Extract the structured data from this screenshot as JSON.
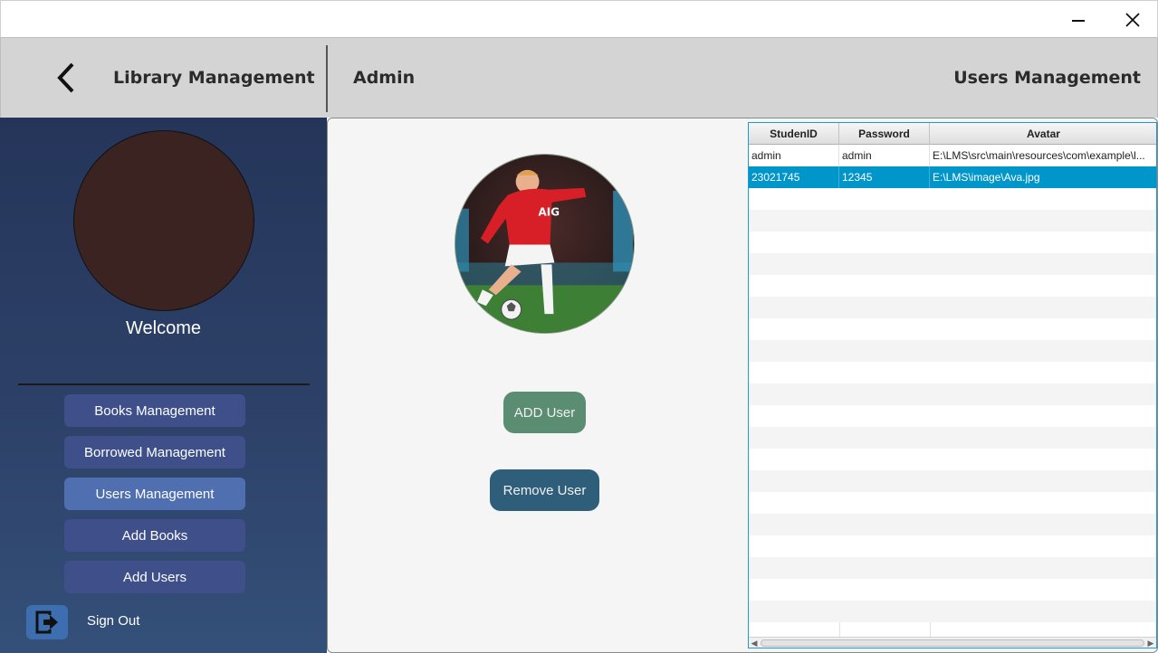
{
  "window": {
    "minimize_icon": "minimize-icon",
    "close_icon": "close-icon"
  },
  "header": {
    "back_icon": "chevron-left-icon",
    "app_title": "Library Management",
    "user_role": "Admin",
    "page_title": "Users Management"
  },
  "sidebar": {
    "welcome": "Welcome",
    "nav": [
      {
        "label": "Books Management",
        "active": false
      },
      {
        "label": "Borrowed Management",
        "active": false
      },
      {
        "label": "Users Management",
        "active": true
      },
      {
        "label": "Add Books",
        "active": false
      },
      {
        "label": "Add Users",
        "active": false
      }
    ],
    "sign_out_label": "Sign Out",
    "sign_out_icon": "sign-out-icon"
  },
  "content": {
    "add_user_label": "ADD User",
    "remove_user_label": "Remove User"
  },
  "table": {
    "columns": [
      "StudenID",
      "Password",
      "Avatar"
    ],
    "rows": [
      [
        "admin",
        "admin",
        "E:\\LMS\\src\\main\\resources\\com\\example\\l..."
      ],
      [
        "23021745",
        "12345",
        "E:\\LMS\\image\\Ava.jpg"
      ]
    ],
    "selected_row": 1
  },
  "colors": {
    "sidebar_bg": "#2d4168",
    "header_bg": "#d4d4d4",
    "add_button": "#5b8d72",
    "remove_button": "#2e5e7a",
    "selected_row": "#0096c9",
    "nav_button": "#3e4f8a"
  }
}
